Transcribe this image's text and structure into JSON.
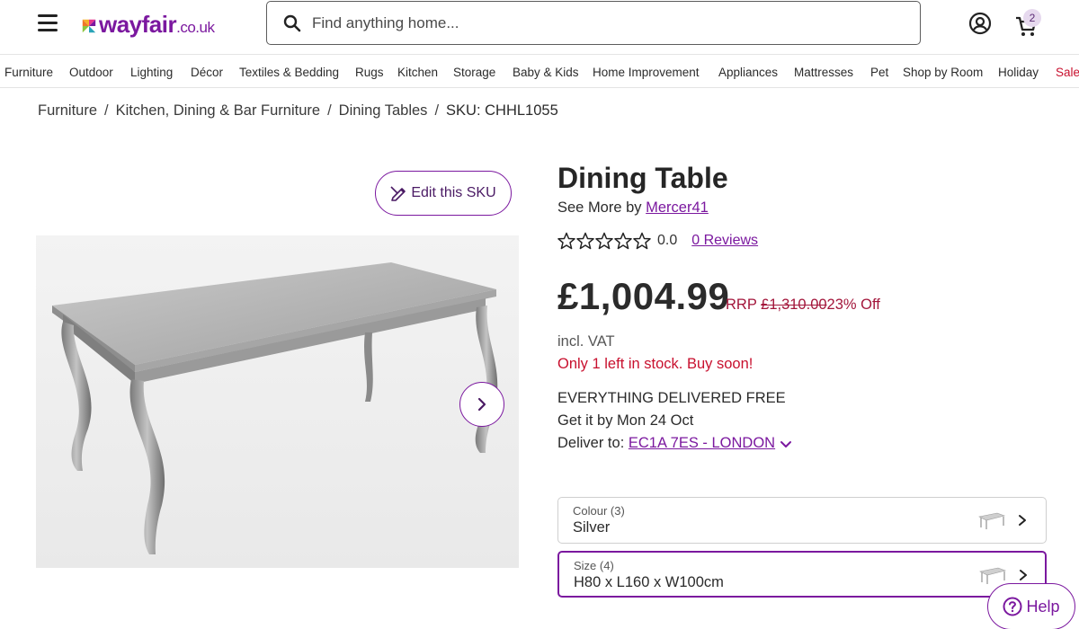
{
  "header": {
    "logo_text": "wayfair",
    "logo_suffix": ".co.uk",
    "search_placeholder": "Find anything home...",
    "cart_count": "2"
  },
  "nav": {
    "items": [
      "Furniture",
      "Outdoor",
      "Lighting",
      "Décor",
      "Textiles & Bedding",
      "Rugs",
      "Kitchen",
      "Storage",
      "Baby & Kids",
      "Home Improvement",
      "Appliances",
      "Mattresses",
      "Pet",
      "Shop by Room",
      "Holiday",
      "Sale"
    ]
  },
  "breadcrumb": {
    "items": [
      "Furniture",
      "Kitchen, Dining & Bar Furniture",
      "Dining Tables"
    ],
    "separator": "/",
    "current": "SKU: CHHL1055"
  },
  "product": {
    "edit_label": "Edit this SKU",
    "title": "Dining Table",
    "see_more_prefix": "See More by",
    "brand": "Mercer41",
    "rating_value": "0.0",
    "reviews_label": "0 Reviews",
    "price": "£1,004.99",
    "rrp_label": "RRP",
    "rrp_price": "£1,310.00",
    "discount": "23% Off",
    "vat": "incl. VAT",
    "stock_message": "Only 1 left in stock. Buy soon!",
    "delivery_free": "EVERYTHING DELIVERED FREE",
    "delivery_date": "Get it by Mon 24 Oct",
    "deliver_to_label": "Deliver to:",
    "deliver_to_value": "EC1A 7ES - LONDON"
  },
  "options": [
    {
      "label": "Colour (3)",
      "value": "Silver"
    },
    {
      "label": "Size (4)",
      "value": "H80 x L160 x W100cm"
    }
  ],
  "help_label": "Help",
  "colors": {
    "brand": "#7b189f",
    "sale": "#c8102e",
    "rrp": "#a3163b"
  }
}
